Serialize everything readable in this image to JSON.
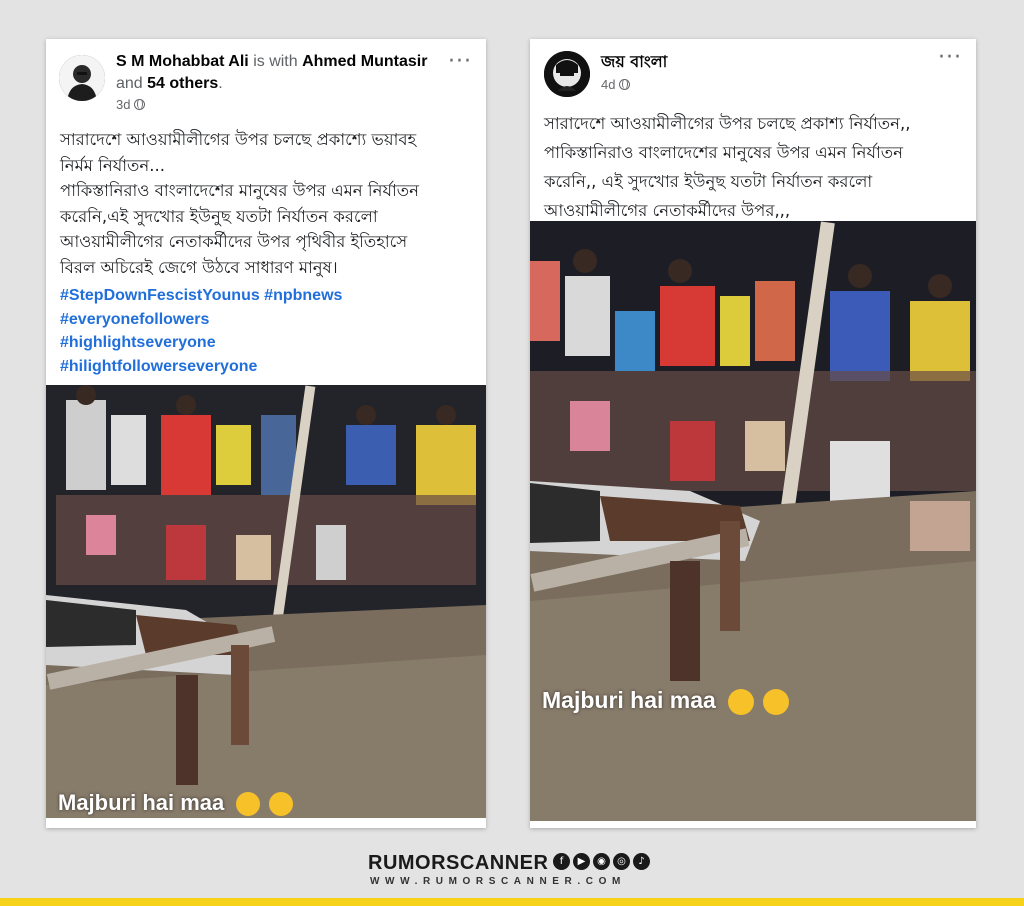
{
  "post1": {
    "author": "S M Mohabbat Ali",
    "with_text": "is with",
    "tagged": "Ahmed Muntasir",
    "and_text": "and",
    "others": "54 others",
    "period": ".",
    "time": "3d",
    "text": "সারাদেশে আওয়ামীলীগের উপর চলছে প্রকাশ্যে ভয়াবহ\nনির্মম নির্যাতন...\nপাকিস্তানিরাও বাংলাদেশের মানুষের উপর এমন নির্যাতন\nকরেনি,এই সুদখোর ইউনুছ যতটা নির্যাতন করলো\nআওয়ামীলীগের নেতাকর্মীদের উপর পৃথিবীর ইতিহাসে\nবিরল অচিরেই জেগে উঠবে সাধারণ মানুষ।",
    "hashtags": [
      "#StepDownFescistYounus #npbnews",
      "#everyonefollowers",
      "#highlightseveryone",
      "#hilightfollowerseveryone"
    ],
    "video_caption": "Majburi hai maa"
  },
  "post2": {
    "author": "জয় বাংলা",
    "time": "4d",
    "text": "সারাদেশে আওয়ামীলীগের উপর চলছে প্রকাশ্য নির্যাতন,,\nপাকিস্তানিরাও বাংলাদেশের মানুষের উপর এমন নির্যাতন\nকরেনি,, এই সুদখোর ইউনুছ যতটা নির্যাতন করলো\nআওয়ামীলীগের নেতাকর্মীদের উপর,,,",
    "video_caption": "Majburi hai maa"
  },
  "more_icon": "···",
  "brand": {
    "name": "RUMORSCANNER",
    "url": "WWW.RUMORSCANNER.COM",
    "social_icons": [
      "f",
      "▶",
      "◉",
      "◎",
      "♪"
    ]
  },
  "colors": {
    "accent_yellow": "#f7d21a",
    "hashtag_blue": "#216fdb",
    "background": "#e3e3e3"
  }
}
